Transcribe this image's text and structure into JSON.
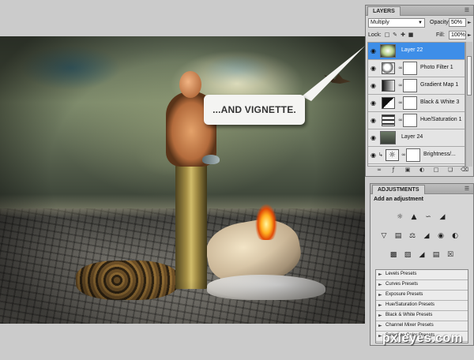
{
  "callout": {
    "text": "...AND VIGNETTE."
  },
  "layers_panel": {
    "tab_label": "LAYERS",
    "blend_mode": "Multiply",
    "opacity_label": "Opacity:",
    "opacity_value": "50%",
    "lock_label": "Lock:",
    "fill_label": "Fill:",
    "fill_value": "100%",
    "layers": [
      {
        "name": "Layer 22",
        "selected": true
      },
      {
        "name": "Photo Filter 1"
      },
      {
        "name": "Gradient Map 1"
      },
      {
        "name": "Black & White 3"
      },
      {
        "name": "Hue/Saturation 1"
      },
      {
        "name": "Layer 24"
      },
      {
        "name": "Brightness/..."
      }
    ]
  },
  "adjustments_panel": {
    "tab_label": "ADJUSTMENTS",
    "title": "Add an adjustment",
    "presets": [
      "Levels Presets",
      "Curves Presets",
      "Exposure Presets",
      "Hue/Saturation Presets",
      "Black & White Presets",
      "Channel Mixer Presets",
      "Selective Color Presets"
    ]
  },
  "watermark": {
    "text": "pxleyes.com"
  },
  "colors": {
    "selection": "#3e8ee8",
    "panel_bg": "#d6d6d6"
  }
}
